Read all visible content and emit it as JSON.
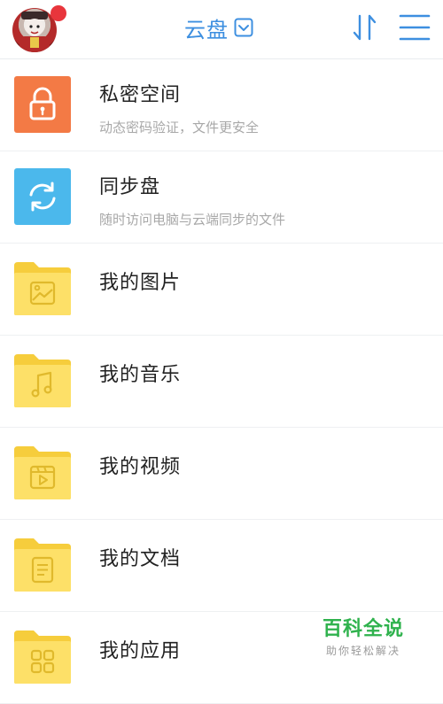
{
  "header": {
    "title": "云盘",
    "icons": {
      "avatar": "avatar",
      "dropdown": "dropdown-icon",
      "sort": "sort-icon",
      "menu": "menu-icon"
    },
    "notification_color": "#e8353c",
    "accent": "#3d8fe0"
  },
  "items": [
    {
      "label": "私密空间",
      "sublabel": "动态密码验证，文件更安全",
      "icon": "lock-icon",
      "color": "#f37a45"
    },
    {
      "label": "同步盘",
      "sublabel": "随时访问电脑与云端同步的文件",
      "icon": "sync-icon",
      "color": "#4bb8ec"
    },
    {
      "label": "我的图片",
      "icon": "folder-image-icon",
      "color": "#fde068"
    },
    {
      "label": "我的音乐",
      "icon": "folder-music-icon",
      "color": "#fde068"
    },
    {
      "label": "我的视频",
      "icon": "folder-video-icon",
      "color": "#fde068"
    },
    {
      "label": "我的文档",
      "icon": "folder-document-icon",
      "color": "#fde068"
    },
    {
      "label": "我的应用",
      "icon": "folder-apps-icon",
      "color": "#fde068"
    }
  ],
  "watermark": {
    "main": "百科全说",
    "sub": "助你轻松解决",
    "color": "#2fb24d"
  }
}
